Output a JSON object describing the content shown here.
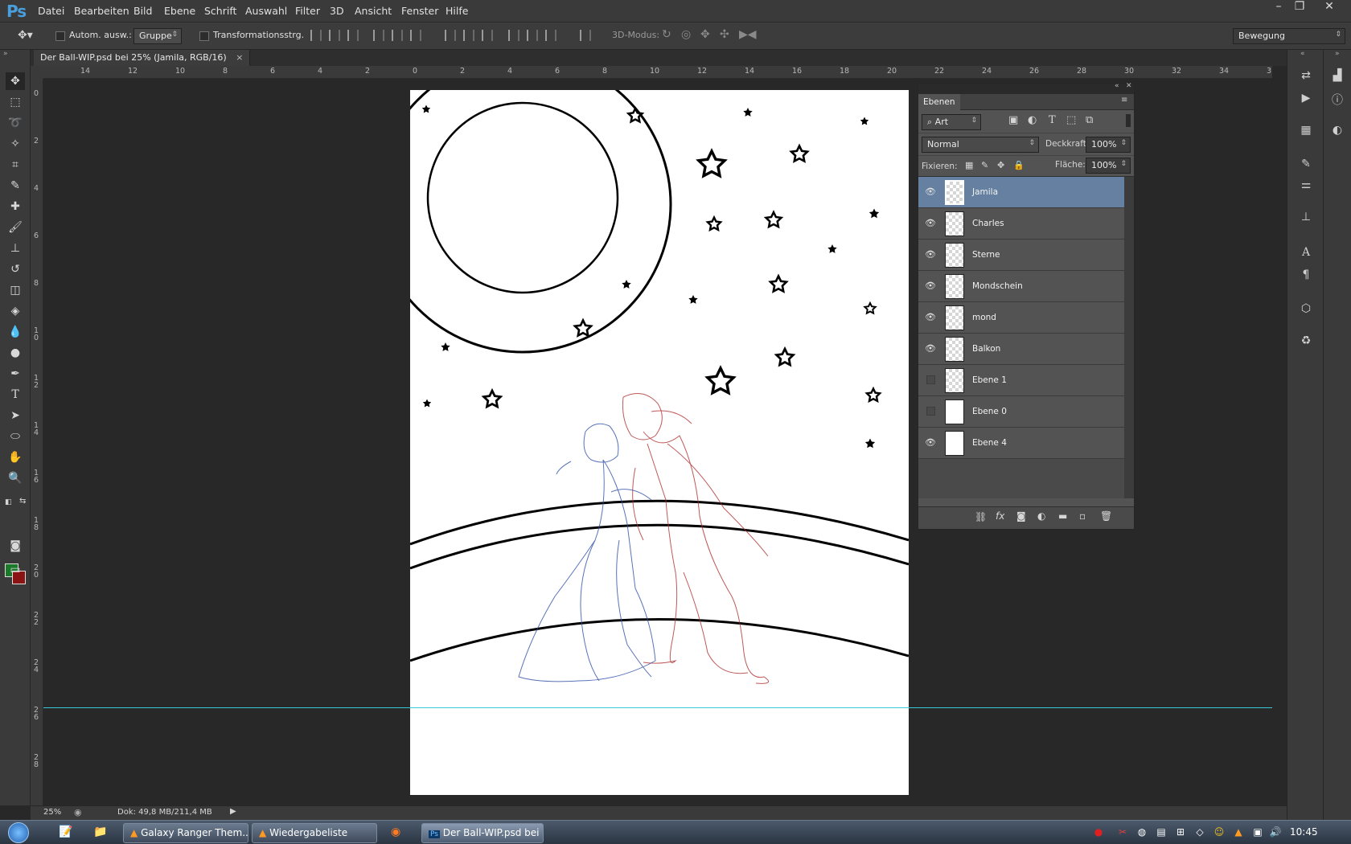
{
  "app": {
    "logo": "Ps"
  },
  "menu": [
    "Datei",
    "Bearbeiten",
    "Bild",
    "Ebene",
    "Schrift",
    "Auswahl",
    "Filter",
    "3D",
    "Ansicht",
    "Fenster",
    "Hilfe"
  ],
  "window_controls": {
    "minimize": "–",
    "restore": "❐",
    "close": "✕"
  },
  "options_bar": {
    "auto_select_label": "Autom. ausw.:",
    "auto_select_value": "Gruppe",
    "transform_label": "Transformationsstrg.",
    "mode_label": "3D-Modus:",
    "workspace_value": "Bewegung"
  },
  "document": {
    "tab_title": "Der Ball-WIP.psd bei 25% (Jamila, RGB/16)",
    "tab_close": "×"
  },
  "rulers": {
    "h": [
      "14",
      "12",
      "10",
      "8",
      "6",
      "4",
      "2",
      "0",
      "2",
      "4",
      "6",
      "8",
      "10",
      "12",
      "14",
      "16",
      "18",
      "20",
      "22",
      "24",
      "26",
      "28",
      "30",
      "32",
      "34",
      "3"
    ],
    "v": [
      "0",
      "2",
      "4",
      "6",
      "8",
      "1 0",
      "1 2",
      "1 4",
      "1 6",
      "1 8",
      "2 0",
      "2 2",
      "2 4",
      "2 6",
      "2 8"
    ]
  },
  "status": {
    "zoom": "25%",
    "doc_info": "Dok: 49,8 MB/211,4 MB"
  },
  "layers_panel": {
    "tab": "Ebenen",
    "filter_kind": "Art",
    "blend_mode": "Normal",
    "opacity_label": "Deckkraft:",
    "opacity_value": "100%",
    "lock_label": "Fixieren:",
    "fill_label": "Fläche:",
    "fill_value": "100%",
    "layers": [
      {
        "name": "Jamila",
        "visible": true,
        "selected": true
      },
      {
        "name": "Charles",
        "visible": true,
        "selected": false
      },
      {
        "name": "Sterne",
        "visible": true,
        "selected": false
      },
      {
        "name": "Mondschein",
        "visible": true,
        "selected": false
      },
      {
        "name": "mond",
        "visible": true,
        "selected": false
      },
      {
        "name": "Balkon",
        "visible": true,
        "selected": false
      },
      {
        "name": "Ebene 1",
        "visible": false,
        "selected": false
      },
      {
        "name": "Ebene 0",
        "visible": false,
        "selected": false
      },
      {
        "name": "Ebene 4",
        "visible": true,
        "selected": false
      }
    ]
  },
  "taskbar": {
    "buttons": [
      "Galaxy Ranger Them...",
      "Wiedergabeliste",
      "Der Ball-WIP.psd bei ..."
    ],
    "clock": "10:45"
  },
  "colors": {
    "foreground": "#1a7a2a",
    "background": "#8a1414",
    "guide": "#39c8d8",
    "selection": "#6580a0"
  }
}
